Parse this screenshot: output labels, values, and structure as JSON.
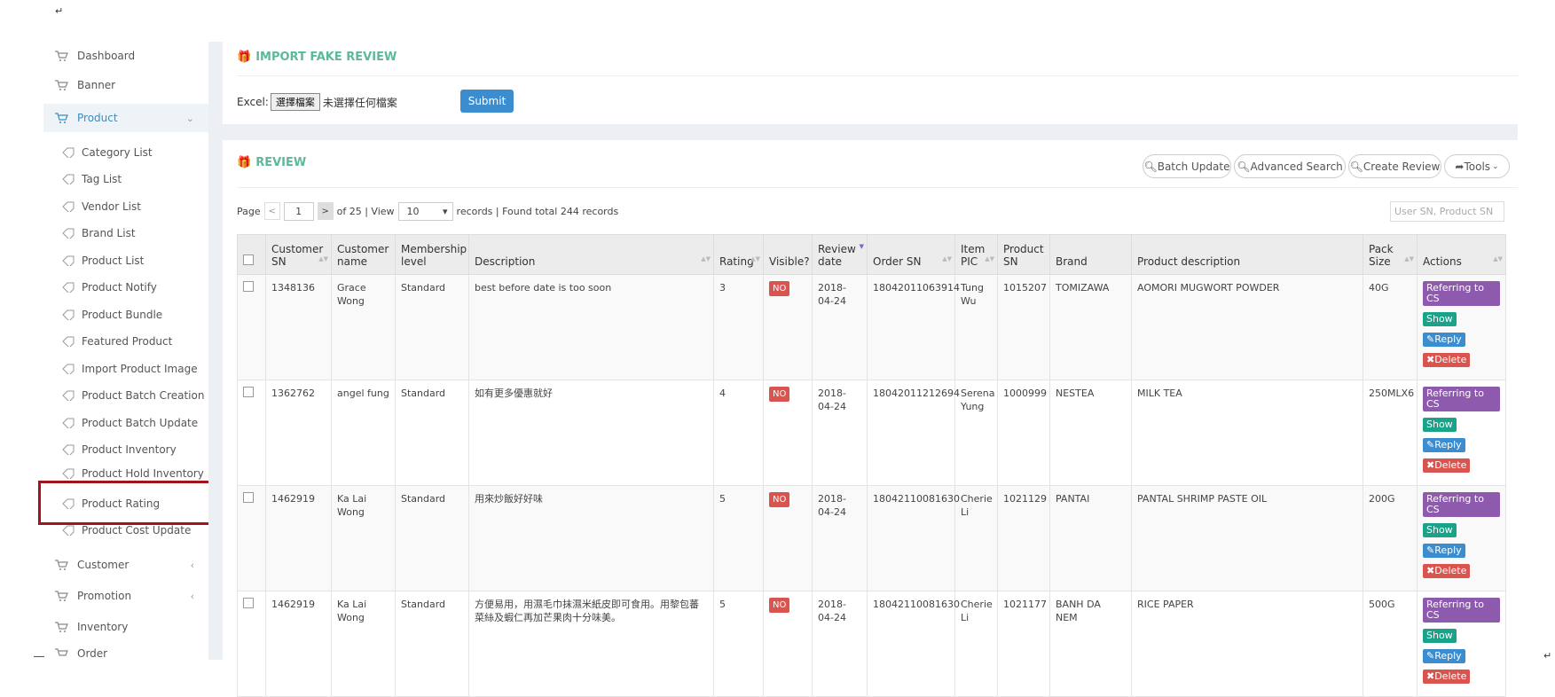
{
  "page": {
    "return_glyph": "↵"
  },
  "sidebar": {
    "items": [
      {
        "label": "Dashboard"
      },
      {
        "label": "Banner"
      },
      {
        "label": "Product",
        "chevron": "⌄"
      },
      {
        "label": "Customer",
        "chevron": "‹"
      },
      {
        "label": "Promotion",
        "chevron": "‹"
      },
      {
        "label": "Inventory"
      },
      {
        "label": "Order"
      }
    ],
    "product_sub": [
      "Category List",
      "Tag List",
      "Vendor List",
      "Brand List",
      "Product List",
      "Product Notify",
      "Product Bundle",
      "Featured Product",
      "Import Product Image",
      "Product Batch Creation",
      "Product Batch Update",
      "Product Inventory",
      "Product Hold Inventory",
      "Product Rating",
      "Product Cost Update"
    ]
  },
  "import_panel": {
    "title": "IMPORT FAKE REVIEW",
    "excel_label": "Excel:",
    "choose_file": "選擇檔案",
    "no_file": "未選擇任何檔案",
    "submit": "Submit"
  },
  "review_panel": {
    "title": "REVIEW",
    "buttons": {
      "batch_update": "Batch Update",
      "advanced_search": "Advanced Search",
      "create_review": "Create Review",
      "tools": "Tools"
    },
    "pager": {
      "page_label": "Page",
      "prev": "<",
      "current": "1",
      "next": ">",
      "of_text": "of 25 | View",
      "per_page": "10",
      "records_text": "records | Found total 244 records"
    },
    "search_placeholder": "User SN, Product SN",
    "columns": {
      "customer_sn": "Customer SN",
      "customer_name": "Customer name",
      "membership": "Membership level",
      "description": "Description",
      "rating": "Rating",
      "visible": "Visible?",
      "review_date": "Review date",
      "order_sn": "Order SN",
      "item_pic": "Item PIC",
      "product_sn": "Product SN",
      "brand": "Brand",
      "product_desc": "Product description",
      "pack_size": "Pack Size",
      "actions": "Actions"
    },
    "action_labels": {
      "cs": "Referring to CS",
      "show": "Show",
      "reply": "✎Reply",
      "delete": "✖Delete"
    },
    "rows": [
      {
        "customer_sn": "1348136",
        "customer_name": "Grace Wong",
        "membership": "Standard",
        "description": "best before date is too soon",
        "rating": "3",
        "visible": "NO",
        "review_date": "2018-04-24",
        "order_sn": "18042011063914",
        "item_pic": "Tung Wu",
        "product_sn": "1015207",
        "brand": "TOMIZAWA",
        "product_desc": "AOMORI MUGWORT POWDER",
        "pack_size": "40G"
      },
      {
        "customer_sn": "1362762",
        "customer_name": "angel fung",
        "membership": "Standard",
        "description": "如有更多優惠就好",
        "rating": "4",
        "visible": "NO",
        "review_date": "2018-04-24",
        "order_sn": "18042011212694",
        "item_pic": "Serena Yung",
        "product_sn": "1000999",
        "brand": "NESTEA",
        "product_desc": "MILK TEA",
        "pack_size": "250MLX6"
      },
      {
        "customer_sn": "1462919",
        "customer_name": "Ka Lai Wong",
        "membership": "Standard",
        "description": "用來炒飯好好味",
        "rating": "5",
        "visible": "NO",
        "review_date": "2018-04-24",
        "order_sn": "18042110081630",
        "item_pic": "Cherie Li",
        "product_sn": "1021129",
        "brand": "PANTAI",
        "product_desc": "PANTAL SHRIMP PASTE OIL",
        "pack_size": "200G"
      },
      {
        "customer_sn": "1462919",
        "customer_name": "Ka Lai Wong",
        "membership": "Standard",
        "description": "方便易用，用濕毛巾抹濕米紙皮即可食用。用黎包蕃菜絲及蝦仁再加芒果肉十分味美。",
        "rating": "5",
        "visible": "NO",
        "review_date": "2018-04-24",
        "order_sn": "18042110081630",
        "item_pic": "Cherie Li",
        "product_sn": "1021177",
        "brand": "BANH DA NEM",
        "product_desc": "RICE PAPER",
        "pack_size": "500G"
      }
    ]
  },
  "icons": {
    "cart": "cart-icon",
    "tag": "tag-icon",
    "gift": "gift-icon",
    "search": "search-icon",
    "share": "share-icon"
  },
  "colors": {
    "accent_green": "#5bb99b",
    "link_blue": "#3c8dbc",
    "danger": "#d9534f",
    "purple": "#8e5aad",
    "teal": "#1aa389",
    "highlight_red": "#a0141d"
  }
}
